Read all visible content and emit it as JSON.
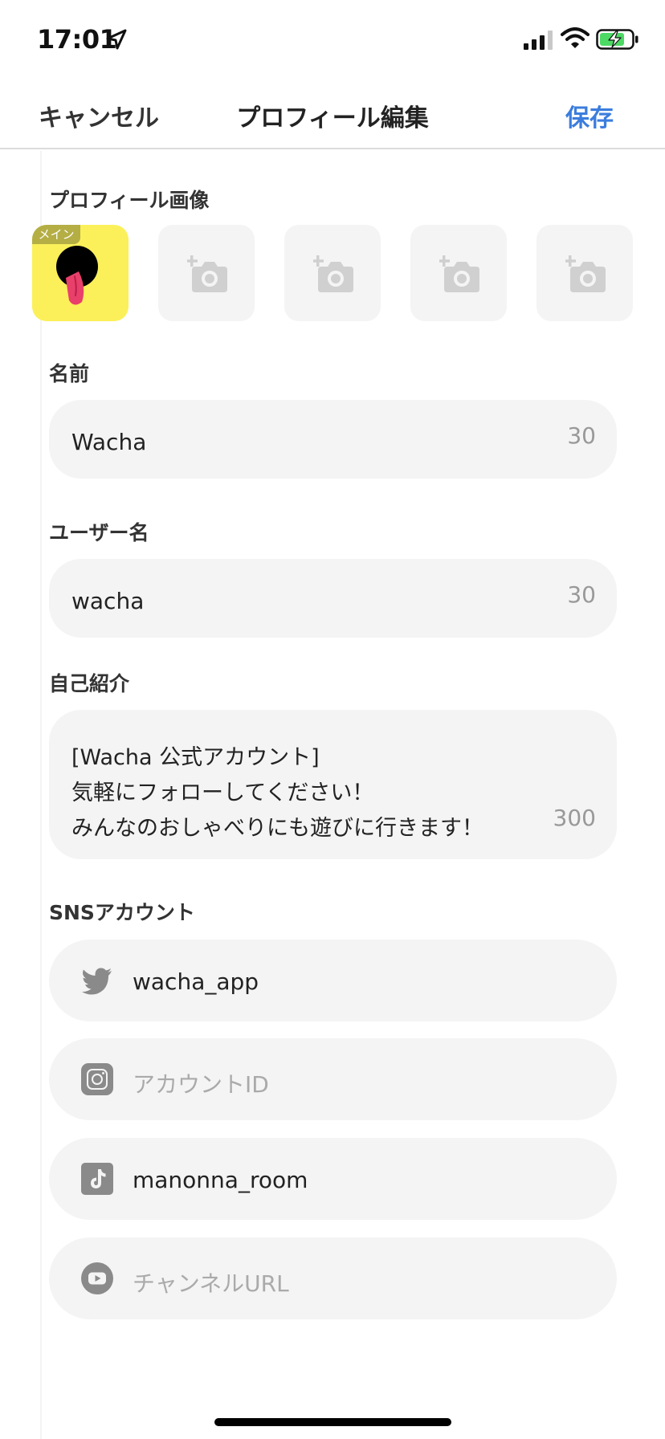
{
  "status_bar": {
    "time": "17:01"
  },
  "nav": {
    "cancel_label": "キャンセル",
    "title": "プロフィール編集",
    "save_label": "保存",
    "accent_color": "#3b7ddd"
  },
  "profile_images": {
    "label": "プロフィール画像",
    "main_badge": "メイン",
    "empty_slot_icon": "add-photo-icon"
  },
  "name": {
    "label": "名前",
    "value": "Wacha",
    "remaining": "30"
  },
  "username": {
    "label": "ユーザー名",
    "value": "wacha",
    "remaining": "30"
  },
  "bio": {
    "label": "自己紹介",
    "lines": [
      "[Wacha 公式アカウント]",
      "気軽にフォローしてください！",
      "みんなのおしゃべりにも遊びに行きます！"
    ],
    "remaining": "300"
  },
  "sns": {
    "label": "SNSアカウント",
    "items": [
      {
        "icon": "twitter-icon",
        "value": "wacha_app",
        "placeholder": ""
      },
      {
        "icon": "instagram-icon",
        "value": "",
        "placeholder": "アカウントID"
      },
      {
        "icon": "tiktok-icon",
        "value": "manonna_room",
        "placeholder": ""
      },
      {
        "icon": "youtube-icon",
        "value": "",
        "placeholder": "チャンネルURL"
      }
    ]
  }
}
